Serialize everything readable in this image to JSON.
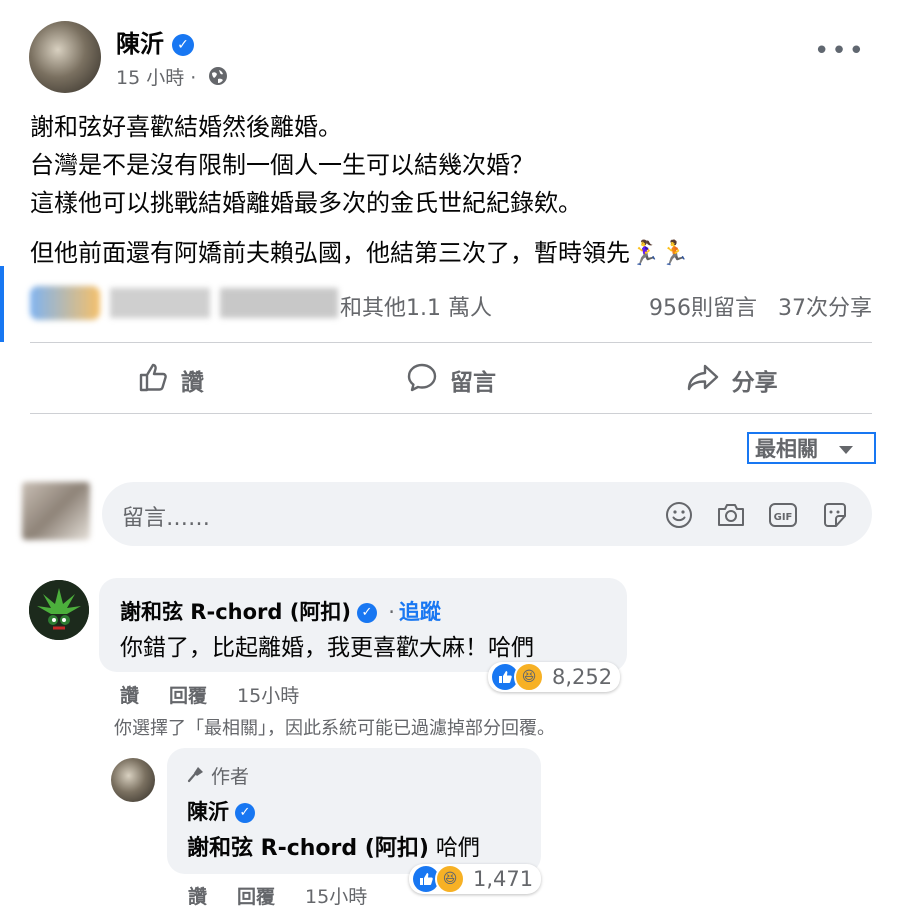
{
  "post": {
    "author": "陳沂",
    "time": "15 小時",
    "separator": "·",
    "body": [
      "謝和弦好喜歡結婚然後離婚。",
      "台灣是不是沒有限制一個人一生可以結幾次婚？",
      "這樣他可以挑戰結婚離婚最多次的金氏世紀紀錄欸。",
      "但他前面還有阿嬌前夫賴弘國，他結第三次了，暫時領先🏃‍♀️🏃"
    ],
    "reactions_text": "和其他1.1 萬人",
    "comments_count": "956則留言",
    "shares_count": "37次分享"
  },
  "actions": {
    "like": "讚",
    "comment": "留言",
    "share": "分享"
  },
  "sort": {
    "label": "最相關"
  },
  "composer": {
    "placeholder": "留言……"
  },
  "comment1": {
    "author": "謝和弦 R-chord (阿扣)",
    "dot": "·",
    "follow": "追蹤",
    "text": "你錯了，比起離婚，我更喜歡大麻！哈們",
    "reactions": "8,252",
    "like": "讚",
    "reply": "回覆",
    "time": "15小時"
  },
  "filter_note": "你選擇了「最相關」，因此系統可能已過濾掉部分回覆。",
  "reply1": {
    "badge": "作者",
    "author": "陳沂",
    "mention": "謝和弦 R-chord (阿扣)",
    "text": " 哈們",
    "reactions": "1,471",
    "like": "讚",
    "reply": "回覆",
    "time": "15小時"
  },
  "colors": {
    "accent": "#1877f2",
    "muted": "#65676b",
    "bubble": "#f0f2f5"
  }
}
